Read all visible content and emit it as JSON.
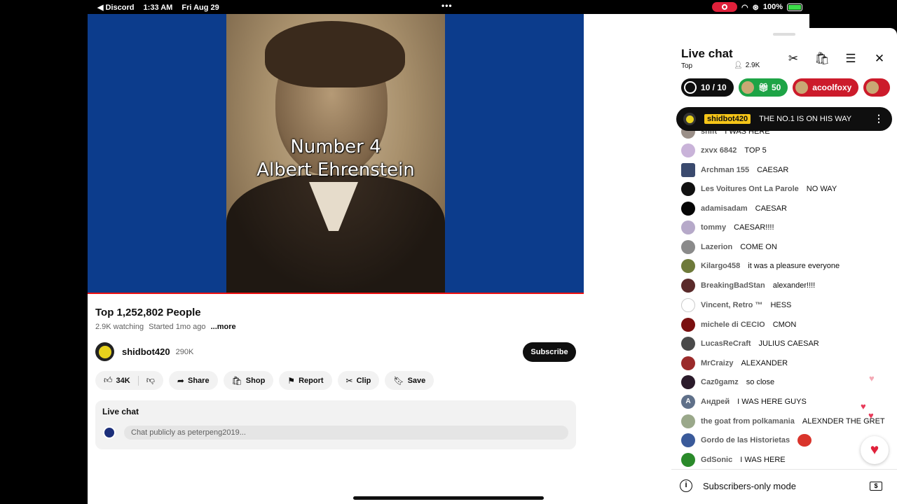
{
  "status_bar": {
    "back_app": "◀ Discord",
    "time": "1:33 AM",
    "date": "Fri Aug 29",
    "dots": "•••",
    "battery": "100%"
  },
  "video": {
    "overlay_line1": "Number 4",
    "overlay_line2": "Albert Ehrenstein",
    "progress_color": "#ee1111"
  },
  "stream": {
    "title": "Top 1,252,802 People",
    "watching": "2.9K watching",
    "started": "Started 1mo ago",
    "more": "...more"
  },
  "channel": {
    "name": "shidbot420",
    "subscribers": "290K",
    "subscribe_label": "Subscribe"
  },
  "actions": {
    "likes": "34K",
    "share": "Share",
    "shop": "Shop",
    "report": "Report",
    "clip": "Clip",
    "save": "Save"
  },
  "live_chat_card": {
    "title": "Live chat",
    "placeholder": "Chat publicly as peterpeng2019..."
  },
  "chat_panel": {
    "title": "Live chat",
    "mode": "Top",
    "viewers": "2.9K",
    "chips": {
      "goal": "10 / 10",
      "gift": "50",
      "user": "acoolfoxy"
    },
    "pinned": {
      "user": "shidbot420",
      "message": "THE NO.1 IS ON HIS WAY"
    },
    "messages": [
      {
        "author": "shift",
        "text": "I WAS HERE",
        "color": "#9a8f88"
      },
      {
        "author": "zxvx 6842",
        "text": "TOP 5",
        "color": "#c9b3d9"
      },
      {
        "author": "Archman 155",
        "text": "CAESAR",
        "color": "#3a4a6e"
      },
      {
        "author": "Les Voitures Ont La Parole",
        "text": "NO WAY",
        "color": "#111111"
      },
      {
        "author": "adamisadam",
        "text": "CAESAR",
        "color": "#050505"
      },
      {
        "author": "tommy",
        "text": "CAESAR!!!!",
        "color": "#b6a9c9"
      },
      {
        "author": "Lazerion",
        "text": "COME ON",
        "color": "#8a8a8a"
      },
      {
        "author": "Kilargo458",
        "text": "it was a pleasure everyone",
        "color": "#6e7a3a"
      },
      {
        "author": "BreakingBadStan",
        "text": "alexander!!!!",
        "color": "#5a2a2a"
      },
      {
        "author": "Vincent, Retro ™",
        "text": "HESS",
        "color": "#ffffff"
      },
      {
        "author": "michele di CECIO",
        "text": "CMON",
        "color": "#7a1010"
      },
      {
        "author": "LucasReCraft",
        "text": "JULIUS CAESAR",
        "color": "#4a4a4a"
      },
      {
        "author": "MrCraizy",
        "text": "ALEXANDER",
        "color": "#9a2a2a"
      },
      {
        "author": "Caz0gamz",
        "text": "so close",
        "color": "#2a1a2a"
      },
      {
        "author": "Андрей",
        "text": "I WAS HERE GUYS",
        "color": "#5f7089"
      },
      {
        "author": "the goat from polkamania",
        "text": "ALEXNDER THE GRET",
        "color": "#9aa88a"
      },
      {
        "author": "Gordo de las Historietas",
        "text": "",
        "color": "#3a5a9a"
      },
      {
        "author": "GdSonic",
        "text": "I WAS HERE",
        "color": "#2a8a2a"
      }
    ],
    "footer": "Subscribers-only mode",
    "footer_badge": "$"
  }
}
